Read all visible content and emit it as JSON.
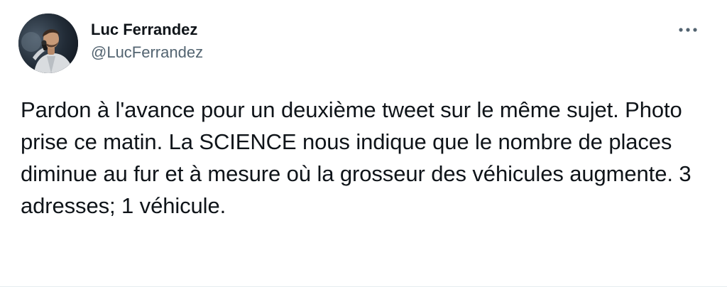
{
  "author": {
    "display_name": "Luc Ferrandez",
    "handle": "@LucFerrandez",
    "avatar_icon": "profile-photo"
  },
  "actions": {
    "more_icon": "more-options-icon"
  },
  "tweet": {
    "text": "Pardon à l'avance pour un deuxième tweet sur le même sujet. Photo prise ce matin. La SCIENCE nous indique que le nombre de places diminue au fur et à mesure où la grosseur des véhicules augmente. 3 adresses; 1 véhicule."
  },
  "colors": {
    "primary_text": "#0f1419",
    "secondary_text": "#536471",
    "background": "#ffffff"
  }
}
